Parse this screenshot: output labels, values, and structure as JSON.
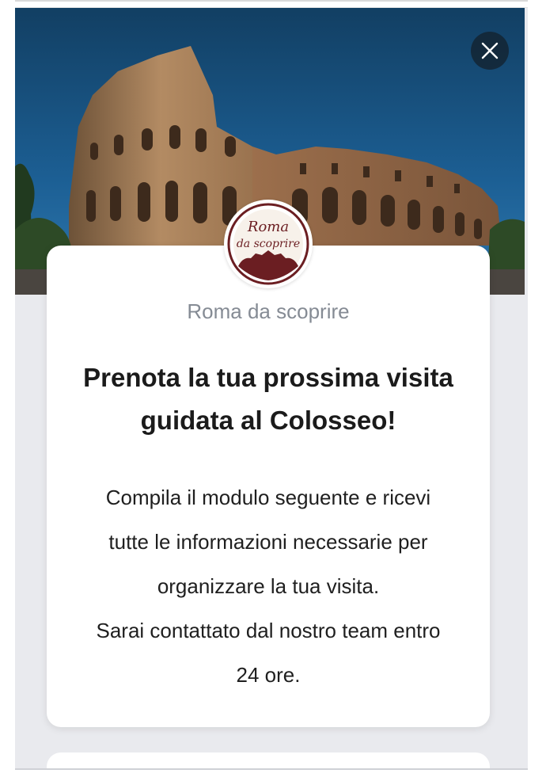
{
  "hero": {
    "image": "colosseum-photo",
    "close_icon": "close-icon"
  },
  "brand": {
    "logo_line1": "Roma",
    "logo_line2": "da scoprire",
    "name": "Roma da scoprire"
  },
  "content": {
    "headline": "Prenota la tua prossima visita guidata al Colosseo!",
    "body_lines": [
      "Compila il modulo seguente e ricevi",
      "tutte le informazioni necessarie per",
      "organizzare la tua visita.",
      "Sarai contattato dal nostro team entro",
      "24 ore."
    ]
  },
  "colors": {
    "sky": "#1d5f96",
    "stone": "#a9825e",
    "logo_accent": "#6b1e22",
    "page_bg": "#e9eaee"
  }
}
